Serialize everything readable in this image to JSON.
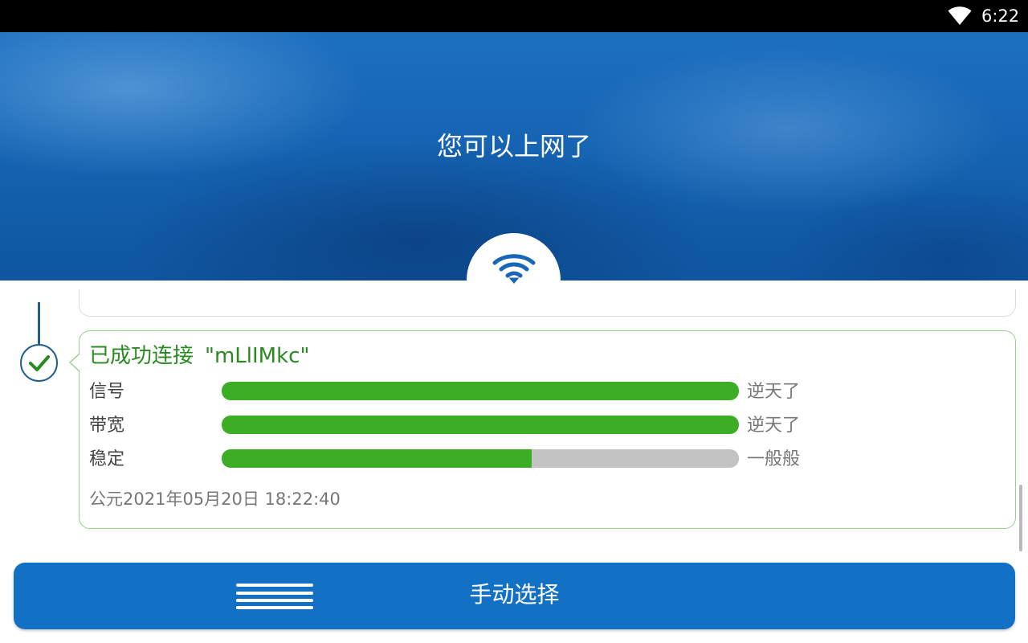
{
  "status_bar": {
    "time": "6:22",
    "icon": "wifi-signal-icon"
  },
  "hero": {
    "title": "您可以上网了",
    "icon": "wifi-icon"
  },
  "result": {
    "status_icon": "check-icon",
    "title": "已成功连接",
    "ssid": "\"mLlIMkc\"",
    "metrics": [
      {
        "label": "信号",
        "level": 1.0,
        "rating": "逆天了"
      },
      {
        "label": "带宽",
        "level": 1.0,
        "rating": "逆天了"
      },
      {
        "label": "稳定",
        "level": 0.6,
        "rating": "一般般"
      }
    ],
    "timestamp": "公元2021年05月20日 18:22:40"
  },
  "bottom_button": {
    "icon": "menu-icon",
    "label": "手动选择"
  },
  "colors": {
    "brand_blue": "#1271c4",
    "success_green": "#3cae24",
    "title_green": "#2a8a22",
    "track_gray": "#c3c3c3"
  }
}
